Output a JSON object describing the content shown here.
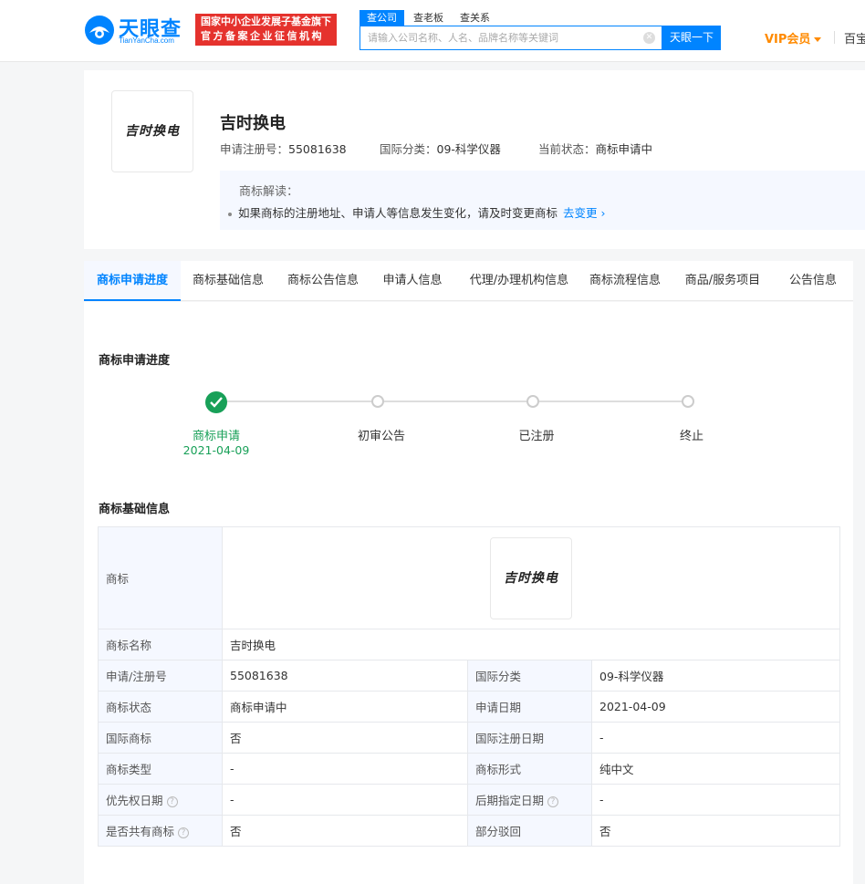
{
  "header": {
    "logo_text": "天眼查",
    "logo_sub": "TianYanCha.com",
    "badge_line1": "国家中小企业发展子基金旗下",
    "badge_line2": "官方备案企业征信机构",
    "search_tabs": [
      "查公司",
      "查老板",
      "查关系"
    ],
    "search_placeholder": "请输入公司名称、人名、品牌名称等关键词",
    "search_button": "天眼一下",
    "vip_label": "VIP会员",
    "more_label": "百宝"
  },
  "trademark": {
    "logo_text": "吉时换电",
    "name": "吉时换电",
    "reg_no_label": "申请注册号：",
    "reg_no": "55081638",
    "class_label": "国际分类：",
    "class": "09-科学仪器",
    "status_label": "当前状态：",
    "status": "商标申请中",
    "notice_head": "商标解读：",
    "notice_text": "如果商标的注册地址、申请人等信息发生变化，请及时变更商标",
    "notice_link": "去变更"
  },
  "tabs": [
    "商标申请进度",
    "商标基础信息",
    "商标公告信息",
    "申请人信息",
    "代理/办理机构信息",
    "商标流程信息",
    "商品/服务项目",
    "公告信息"
  ],
  "progress": {
    "title": "商标申请进度",
    "steps": [
      {
        "label": "商标申请",
        "date": "2021-04-09"
      },
      {
        "label": "初审公告"
      },
      {
        "label": "已注册"
      },
      {
        "label": "终止"
      }
    ]
  },
  "basic_info": {
    "title": "商标基础信息",
    "rows": {
      "logo_label": "商标",
      "name_label": "商标名称",
      "name_value": "吉时换电",
      "reg_no_label": "申请/注册号",
      "reg_no_value": "55081638",
      "class_label": "国际分类",
      "class_value": "09-科学仪器",
      "status_label": "商标状态",
      "status_value": "商标申请中",
      "apply_date_label": "申请日期",
      "apply_date_value": "2021-04-09",
      "intl_label": "国际商标",
      "intl_value": "否",
      "intl_reg_date_label": "国际注册日期",
      "intl_reg_date_value": "-",
      "type_label": "商标类型",
      "type_value": "-",
      "form_label": "商标形式",
      "form_value": "纯中文",
      "priority_date_label": "优先权日期",
      "priority_date_value": "-",
      "later_date_label": "后期指定日期",
      "later_date_value": "-",
      "shared_label": "是否共有商标",
      "shared_value": "否",
      "partial_reject_label": "部分驳回",
      "partial_reject_value": "否"
    }
  },
  "colors": {
    "primary": "#0084ff",
    "success": "#18a058",
    "vip": "#ff8a00",
    "badge": "#e5322d"
  }
}
